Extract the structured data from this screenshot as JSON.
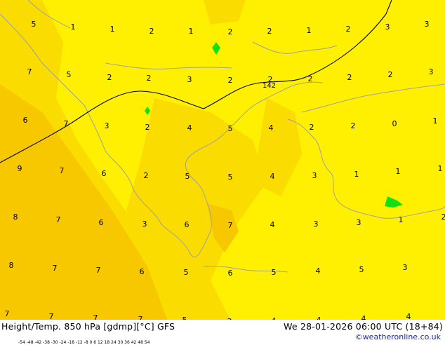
{
  "map": {
    "colors": {
      "background_light": "#fef000",
      "background_mid": "#fbdc00",
      "background_orange": "#f7c800",
      "green_patch": "#12e012",
      "coastline": "#a0a0a0",
      "contour": "#000000"
    },
    "contour_label": "142",
    "temperature_labels": [
      "5",
      "1",
      "1",
      "2",
      "1",
      "2",
      "2",
      "1",
      "2",
      "3",
      "3",
      "7",
      "5",
      "2",
      "2",
      "3",
      "2",
      "2",
      "2",
      "2",
      "2",
      "3",
      "6",
      "7",
      "3",
      "2",
      "4",
      "5",
      "4",
      "2",
      "2",
      "0",
      "1",
      "9",
      "7",
      "6",
      "2",
      "5",
      "5",
      "4",
      "3",
      "1",
      "1",
      "1",
      "8",
      "7",
      "6",
      "3",
      "6",
      "7",
      "4",
      "3",
      "3",
      "1",
      "2",
      "8",
      "7",
      "7",
      "6",
      "5",
      "6",
      "5",
      "4",
      "5",
      "3",
      "7",
      "7",
      "7",
      "7",
      "5",
      "3",
      "4",
      "4",
      "4",
      "4"
    ]
  },
  "footer": {
    "title_left": "Height/Temp. 850 hPa [gdmp][°C] GFS",
    "title_right": "We 28-01-2026 06:00 UTC (18+84)",
    "credit": "©weatheronline.co.uk",
    "scale_ticks": "-54 -48 -42 -38 -30 -24 -18 -12 -8  0  6  12 18 24 30 36 42 48 54",
    "scale_colors": [
      "#7c7c7c",
      "#a8a8a8",
      "#cc66cc",
      "#9933cc",
      "#3333ff",
      "#3399ff",
      "#33ccff",
      "#00c070",
      "#009900",
      "#33cc33",
      "#ffff00",
      "#ffcc00",
      "#ff9900",
      "#ff4400",
      "#dd0000",
      "#aa0000",
      "#660000"
    ]
  }
}
